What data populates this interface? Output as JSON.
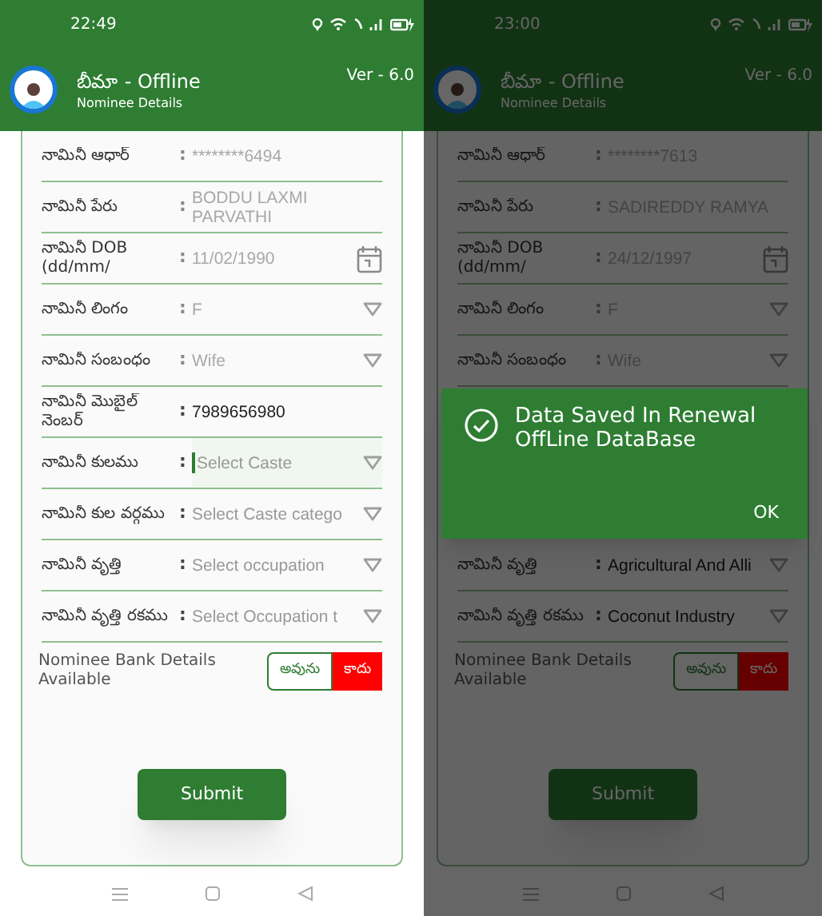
{
  "screens": [
    {
      "time": "22:49",
      "separator": ":",
      "app_title": "బీమా - Offline",
      "subtitle": "Nominee Details",
      "version": "Ver - 6.0",
      "dimmed": false,
      "fields": [
        {
          "label": "నామినీ ఆధార్",
          "value": "********6494",
          "kind": "text",
          "disabled": true,
          "focused": false
        },
        {
          "label": "నామినీ పేరు",
          "value": "BODDU LAXMI PARVATHI",
          "kind": "text",
          "disabled": true,
          "focused": false
        },
        {
          "label": "నామినీ DOB (dd/mm/",
          "value": "11/02/1990",
          "kind": "date",
          "disabled": true,
          "focused": false
        },
        {
          "label": "నామినీ లింగం",
          "value": "F",
          "kind": "dropdown",
          "disabled": true,
          "focused": false
        },
        {
          "label": "నామినీ సంబంధం",
          "value": "Wife",
          "kind": "dropdown",
          "disabled": true,
          "focused": false
        },
        {
          "label": "నామినీ మొబైల్ నెంబర్",
          "value": "7989656980",
          "kind": "text",
          "disabled": false,
          "focused": false
        },
        {
          "label": "నామినీ కులము",
          "placeholder": "Select Caste",
          "kind": "dropdown",
          "disabled": false,
          "focused": true
        },
        {
          "label": "నామినీ కుల వర్గము",
          "placeholder": "Select Caste catego",
          "kind": "dropdown",
          "disabled": false,
          "focused": false
        },
        {
          "label": "నామినీ వృత్తి",
          "placeholder": "Select occupation",
          "kind": "dropdown",
          "disabled": false,
          "focused": false
        },
        {
          "label": "నామినీ వృత్తి రకము",
          "placeholder": "Select Occupation t",
          "kind": "dropdown",
          "disabled": false,
          "focused": false
        }
      ],
      "bank_label": "Nominee Bank Details Available",
      "bank_options": [
        {
          "label": "అవును",
          "selected": false
        },
        {
          "label": "కాదు",
          "selected": true
        }
      ],
      "submit": "Submit"
    },
    {
      "time": "23:00",
      "separator": ":",
      "app_title": "బీమా - Offline",
      "subtitle": "Nominee Details",
      "version": "Ver - 6.0",
      "dimmed": true,
      "fields": [
        {
          "label": "నామినీ ఆధార్",
          "value": "********7613",
          "kind": "text",
          "disabled": true,
          "focused": false
        },
        {
          "label": "నామినీ పేరు",
          "value": "SADIREDDY RAMYA",
          "kind": "text",
          "disabled": true,
          "focused": false
        },
        {
          "label": "నామినీ DOB (dd/mm/",
          "value": "24/12/1997",
          "kind": "date",
          "disabled": true,
          "focused": false
        },
        {
          "label": "నామినీ లింగం",
          "value": "F",
          "kind": "dropdown",
          "disabled": true,
          "focused": false
        },
        {
          "label": "నామినీ సంబంధం",
          "value": "Wife",
          "kind": "dropdown",
          "disabled": true,
          "focused": false
        },
        {
          "kind": "dialog"
        },
        {
          "label": "నామినీ వృత్తి",
          "value": "Agricultural And Alli",
          "kind": "dropdown",
          "disabled": false,
          "focused": false
        },
        {
          "label": "నామినీ వృత్తి రకము",
          "value": "Coconut Industry",
          "kind": "dropdown",
          "disabled": false,
          "focused": false
        }
      ],
      "bank_label": "Nominee Bank Details Available",
      "bank_options": [
        {
          "label": "అవును",
          "selected": false
        },
        {
          "label": "కాదు",
          "selected": true
        }
      ],
      "submit": "Submit",
      "dialog": {
        "message": "Data Saved In Renewal OffLine DataBase",
        "button": "OK"
      }
    }
  ]
}
